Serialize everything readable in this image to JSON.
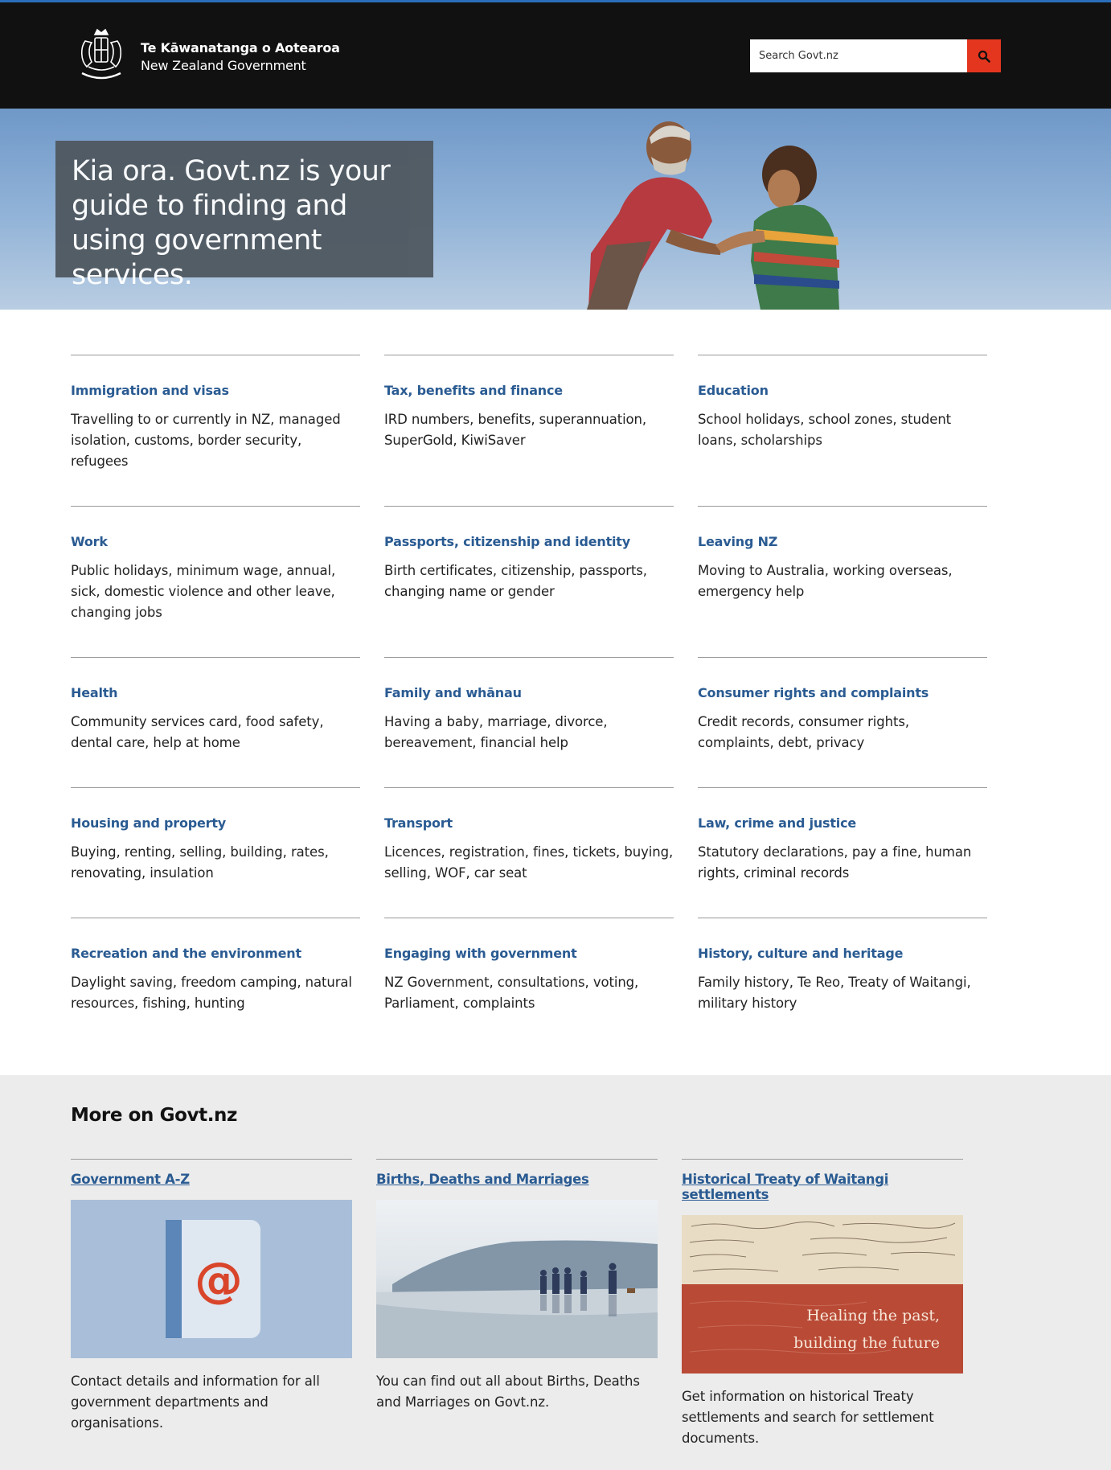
{
  "header": {
    "logo_line1": "Te Kāwanatanga o Aotearoa",
    "logo_line2": "New Zealand Government",
    "search_placeholder": "Search Govt.nz",
    "accent_color": "#e4361f"
  },
  "hero": {
    "heading": "Kia ora. Govt.nz is your guide to finding and using government services."
  },
  "topics": [
    {
      "title": "Immigration and visas",
      "desc": "Travelling to or currently in NZ, managed isolation, customs, border security, refugees"
    },
    {
      "title": "Tax, benefits and finance",
      "desc": "IRD numbers, benefits, superannuation, SuperGold, KiwiSaver"
    },
    {
      "title": "Education",
      "desc": "School holidays, school zones, student loans, scholarships"
    },
    {
      "title": "Work",
      "desc": "Public holidays, minimum wage, annual, sick, domestic violence and other leave, changing jobs"
    },
    {
      "title": "Passports, citizenship and identity",
      "desc": "Birth certificates, citizenship, passports, changing name or gender"
    },
    {
      "title": "Leaving NZ",
      "desc": "Moving to Australia, working overseas, emergency help"
    },
    {
      "title": "Health",
      "desc": "Community services card, food safety, dental care, help at home"
    },
    {
      "title": "Family and whānau",
      "desc": "Having a baby, marriage, divorce, bereavement, financial help"
    },
    {
      "title": "Consumer rights and complaints",
      "desc": "Credit records, consumer rights, complaints, debt, privacy"
    },
    {
      "title": "Housing and property",
      "desc": "Buying, renting, selling, building, rates, renovating, insulation"
    },
    {
      "title": "Transport",
      "desc": "Licences, registration, fines, tickets, buying, selling, WOF, car seat"
    },
    {
      "title": "Law, crime and justice",
      "desc": "Statutory declarations, pay a fine, human rights, criminal records"
    },
    {
      "title": "Recreation and the environment",
      "desc": "Daylight saving, freedom camping, natural resources, fishing, hunting"
    },
    {
      "title": "Engaging with government",
      "desc": "NZ Government, consultations, voting, Parliament, complaints"
    },
    {
      "title": "History, culture and heritage",
      "desc": "Family history, Te Reo, Treaty of Waitangi, military history"
    }
  ],
  "more": {
    "heading": "More on Govt.nz",
    "cards": [
      {
        "title": "Government A-Z",
        "desc": "Contact details and information for all government departments and organisations.",
        "icon": "address-book-icon"
      },
      {
        "title": "Births, Deaths and Marriages",
        "desc": "You can find out all about Births, Deaths and Marriages on Govt.nz."
      },
      {
        "title": "Historical Treaty of Waitangi settlements",
        "desc": "Get information on historical Treaty settlements and search for settlement documents.",
        "image_text_1": "Healing the past,",
        "image_text_2": "building the future"
      }
    ]
  }
}
